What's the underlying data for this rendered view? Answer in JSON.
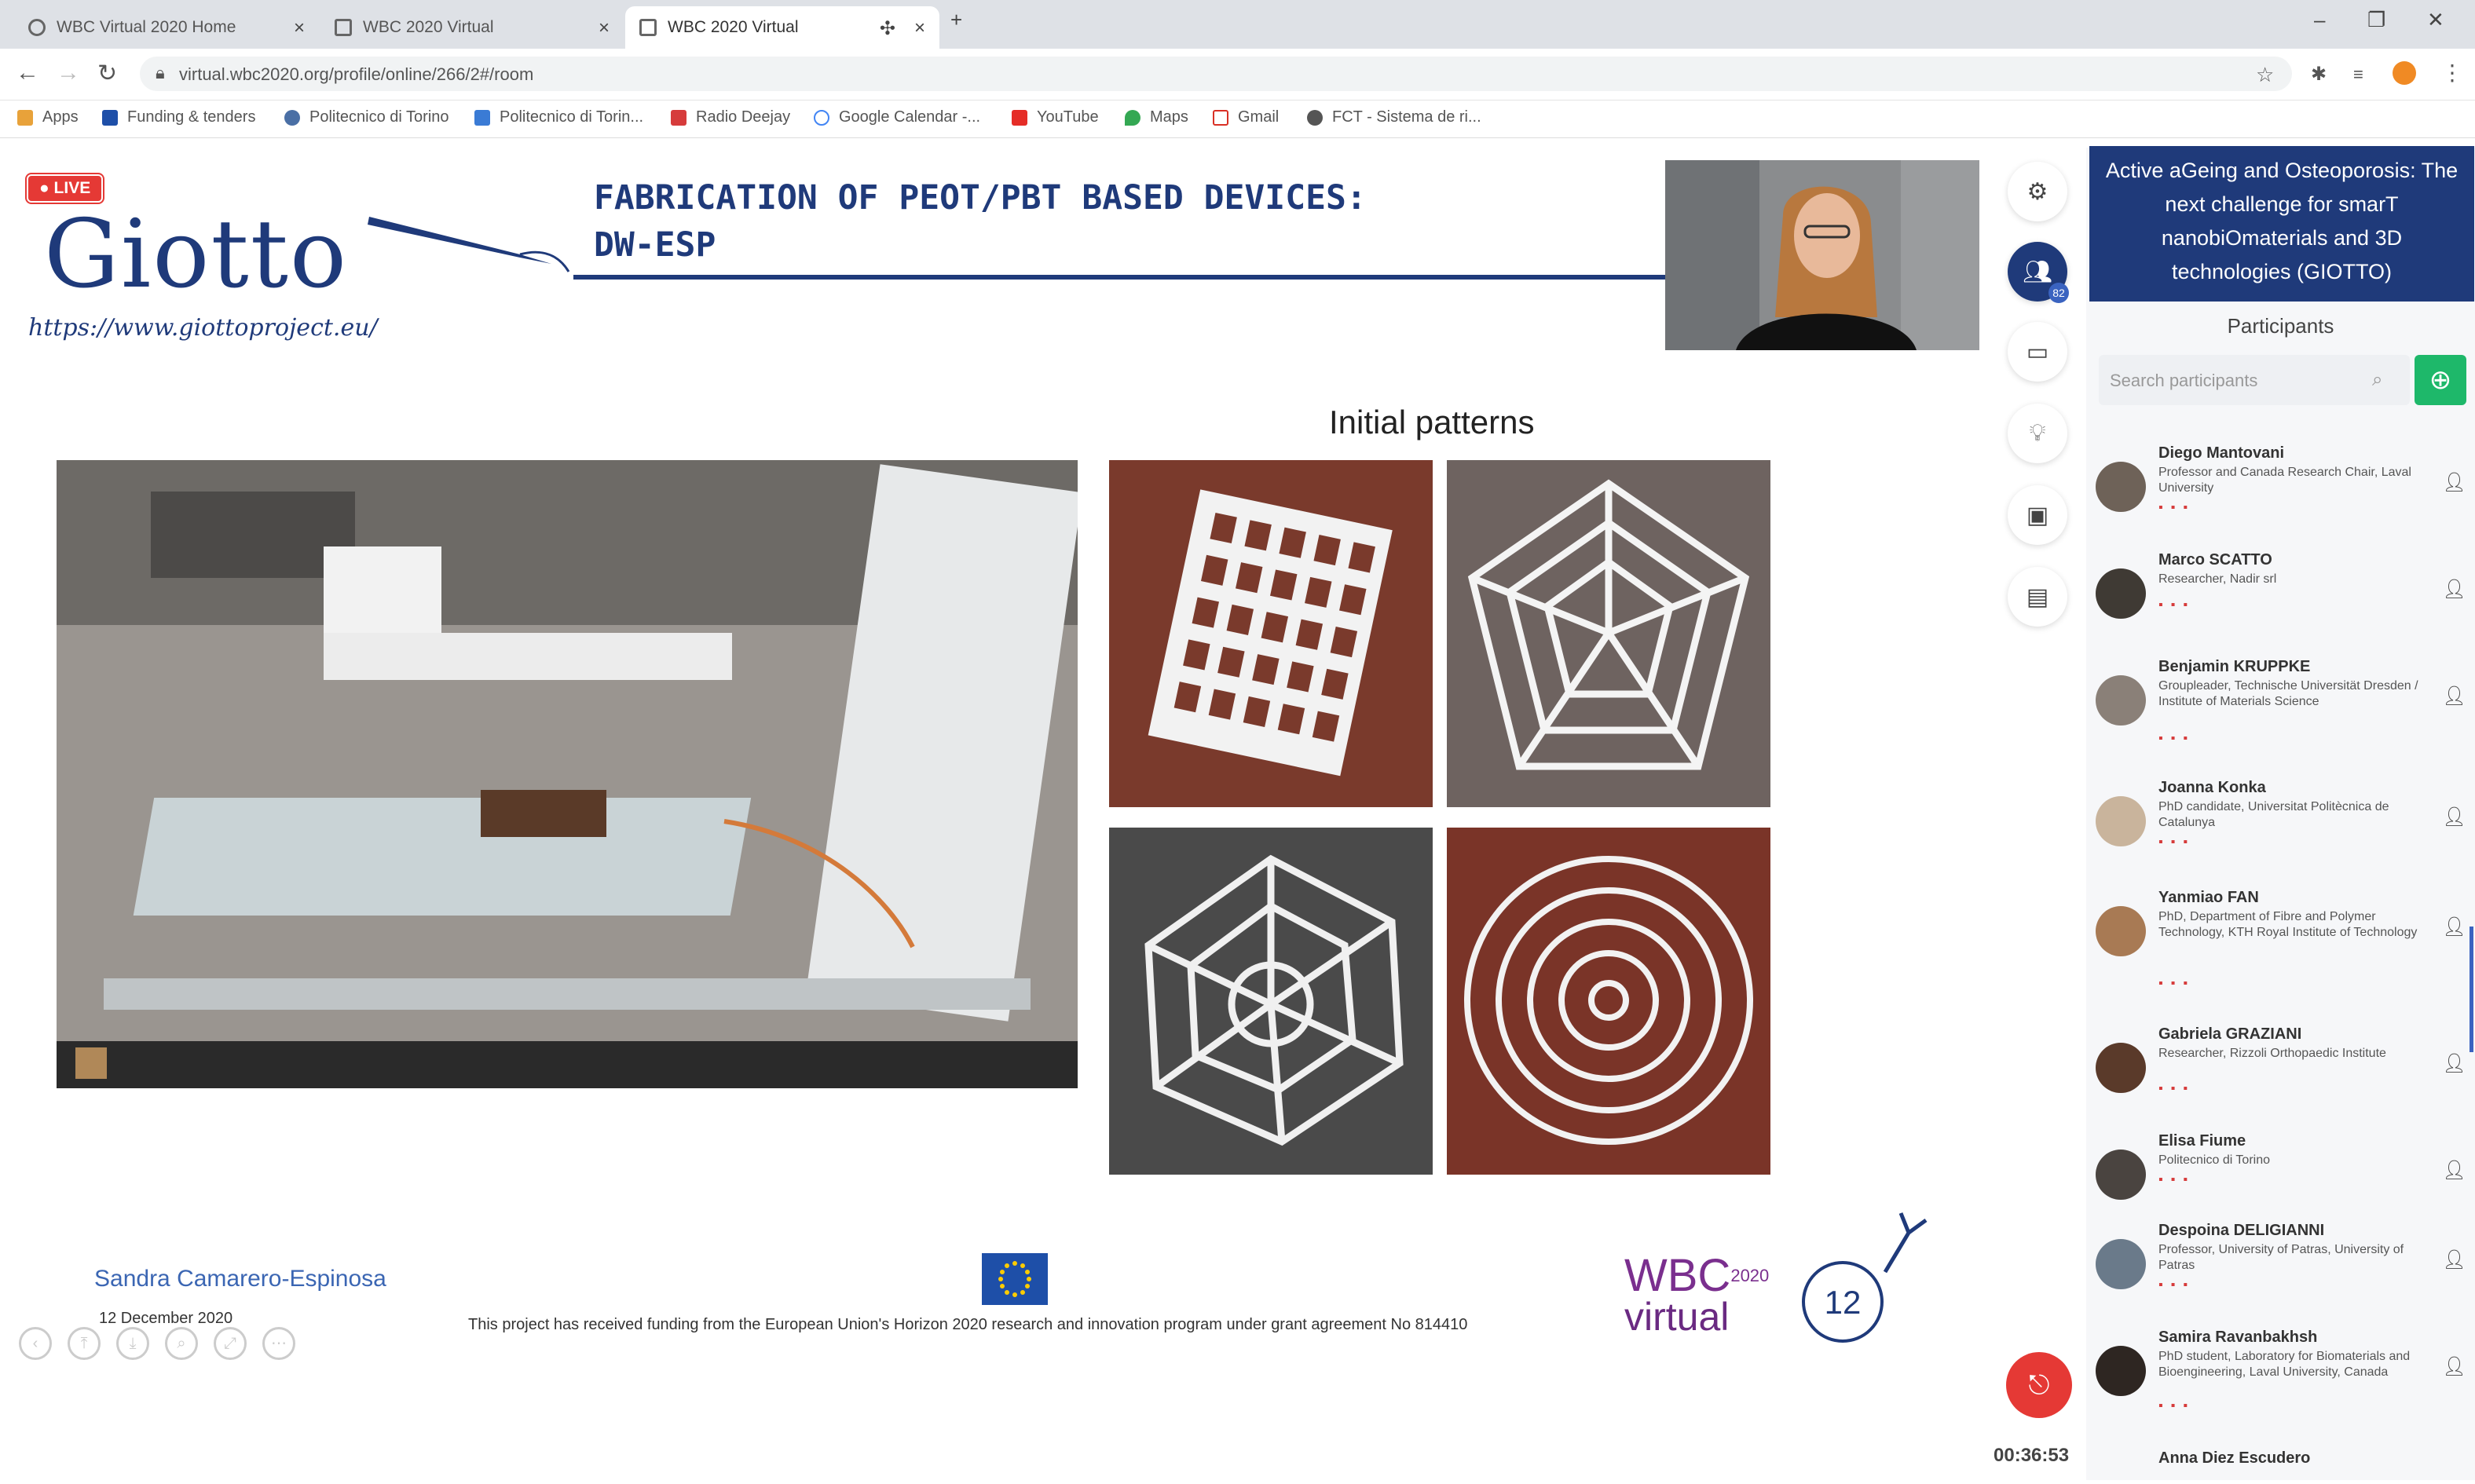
{
  "browser": {
    "tabs": [
      {
        "label": "WBC Virtual 2020 Home"
      },
      {
        "label": "WBC 2020 Virtual"
      },
      {
        "label": "WBC 2020 Virtual"
      }
    ],
    "url": "virtual.wbc2020.org/profile/online/266/2#/room",
    "bookmarks": [
      "Apps",
      "Funding & tenders",
      "Politecnico di Torino",
      "Politecnico di Torin...",
      "Radio Deejay",
      "Google Calendar -...",
      "YouTube",
      "Maps",
      "Gmail",
      "FCT - Sistema de ri..."
    ]
  },
  "live_label": "LIVE",
  "slide": {
    "logo": "Giotto",
    "logo_url": "https://www.giottoproject.eu/",
    "title_line1": "FABRICATION OF PEOT/PBT BASED DEVICES:",
    "title_line2": "DW-ESP",
    "patterns_title": "Initial patterns",
    "presenter": "Sandra Camarero-Espinosa",
    "date": "12 December 2020",
    "funding_note": "This project has received funding from the European Union's Horizon 2020 research and innovation program under grant agreement No 814410",
    "wbc_top": "WBC",
    "wbc_year": "2020",
    "wbc_bottom": "virtual",
    "page_number": "12"
  },
  "toolbar": {
    "participants_badge": "82",
    "timer": "00:36:53"
  },
  "session": {
    "title": "Active aGeing and Osteoporosis: The next challenge for smarT nanobiOmaterials and 3D technologies (GIOTTO)"
  },
  "participants": {
    "heading": "Participants",
    "search_placeholder": "Search participants",
    "list": [
      {
        "name": "Diego Mantovani",
        "role": "Professor and Canada Research Chair, Laval University"
      },
      {
        "name": "Marco SCATTO",
        "role": "Researcher, Nadir srl"
      },
      {
        "name": "Benjamin KRUPPKE",
        "role": "Groupleader, Technische Universität Dresden / Institute of Materials Science"
      },
      {
        "name": "Joanna Konka",
        "role": "PhD candidate, Universitat Politècnica de Catalunya"
      },
      {
        "name": "Yanmiao FAN",
        "role": "PhD, Department of Fibre and Polymer Technology, KTH Royal Institute of Technology"
      },
      {
        "name": "Gabriela GRAZIANI",
        "role": "Researcher, Rizzoli Orthopaedic Institute"
      },
      {
        "name": "Elisa Fiume",
        "role": "Politecnico di Torino"
      },
      {
        "name": "Despoina DELIGIANNI",
        "role": "Professor, University of Patras, University of Patras"
      },
      {
        "name": "Samira Ravanbakhsh",
        "role": "PhD student, Laboratory for Biomaterials and Bioengineering, Laval University, Canada"
      },
      {
        "name": "Anna Diez Escudero",
        "role": ""
      }
    ]
  },
  "colors": {
    "brand": "#1f3a7a",
    "live": "#e53935",
    "add": "#1eb86a",
    "wbc": "#7a2f8e"
  }
}
